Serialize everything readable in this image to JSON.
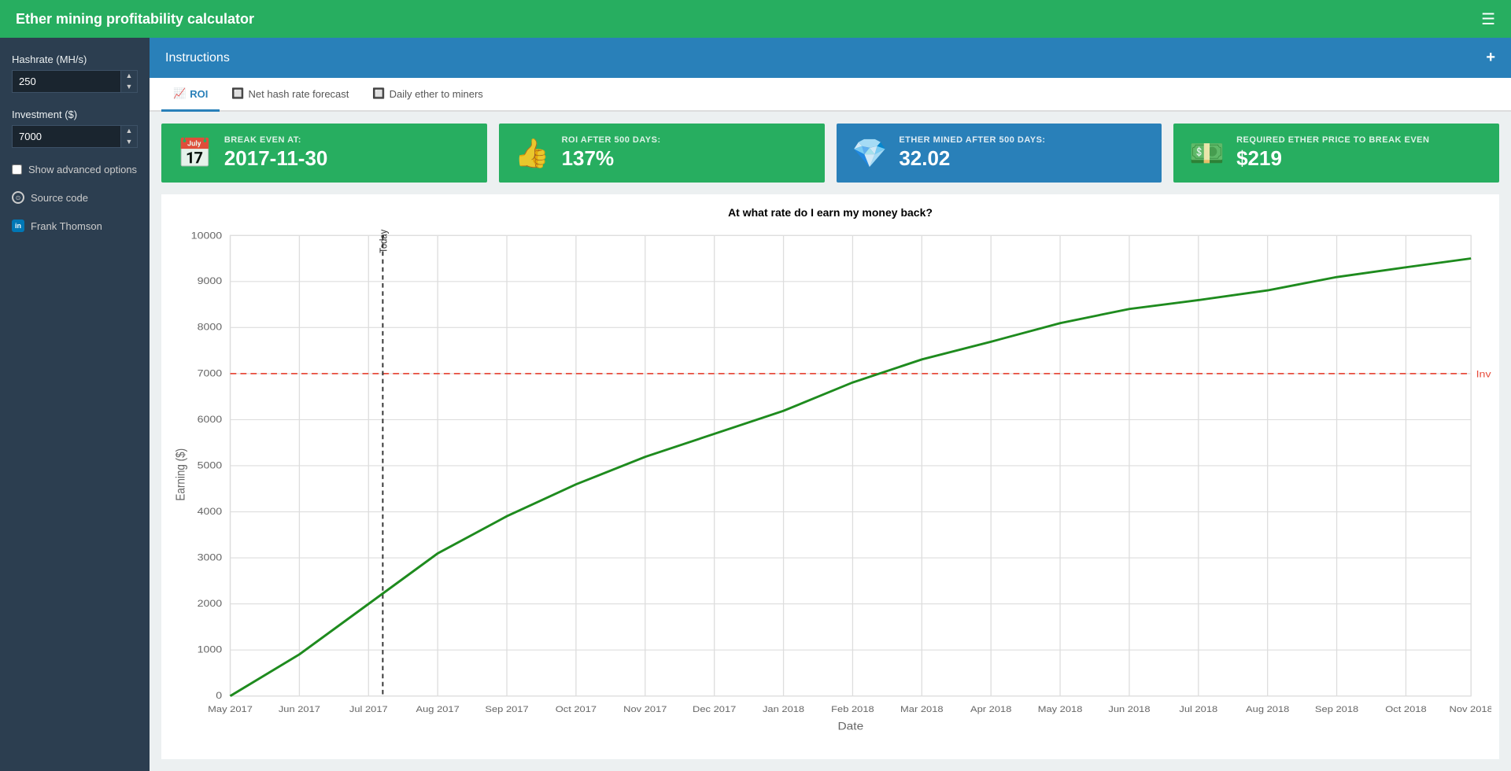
{
  "app": {
    "title": "Ether mining profitability calculator"
  },
  "nav": {
    "hamburger_icon": "☰"
  },
  "sidebar": {
    "hashrate_label": "Hashrate (MH/s)",
    "hashrate_value": "250",
    "investment_label": "Investment ($)",
    "investment_value": "7000",
    "advanced_options_label": "Show advanced options",
    "source_code_label": "Source code",
    "author_label": "Frank Thomson"
  },
  "instructions": {
    "title": "Instructions",
    "plus_icon": "+"
  },
  "tabs": [
    {
      "id": "roi",
      "label": "ROI",
      "active": true
    },
    {
      "id": "net-hash",
      "label": "Net hash rate forecast",
      "active": false
    },
    {
      "id": "daily-ether",
      "label": "Daily ether to miners",
      "active": false
    }
  ],
  "stats": [
    {
      "id": "break-even",
      "label": "BREAK EVEN AT:",
      "value": "2017-11-30",
      "color": "green",
      "icon": "📅"
    },
    {
      "id": "roi-days",
      "label": "ROI AFTER 500 DAYS:",
      "value": "137%",
      "color": "green",
      "icon": "👍"
    },
    {
      "id": "ether-mined",
      "label": "ETHER MINED AFTER 500 DAYS:",
      "value": "32.02",
      "color": "blue",
      "icon": "💎"
    },
    {
      "id": "required-price",
      "label": "REQUIRED ETHER PRICE TO BREAK EVEN",
      "value": "$219",
      "color": "green",
      "icon": "💵"
    }
  ],
  "chart": {
    "title": "At what rate do I earn my money back?",
    "y_axis_label": "Earning ($)",
    "x_axis_label": "Date",
    "investment_line_label": "Investment",
    "investment_value": 7000,
    "today_label": "Today",
    "y_ticks": [
      0,
      1000,
      2000,
      3000,
      4000,
      5000,
      6000,
      7000,
      8000,
      9000,
      10000
    ],
    "x_labels": [
      "May 2017",
      "Jun 2017",
      "Jul 2017",
      "Aug 2017",
      "Sep 2017",
      "Oct 2017",
      "Nov 2017",
      "Dec 2017",
      "Jan 2018",
      "Feb 2018",
      "Mar 2018",
      "Apr 2018",
      "May 2018",
      "Jun 2018",
      "Jul 2018",
      "Aug 2018",
      "Sep 2018",
      "Oct 2018",
      "Nov 2018"
    ]
  }
}
